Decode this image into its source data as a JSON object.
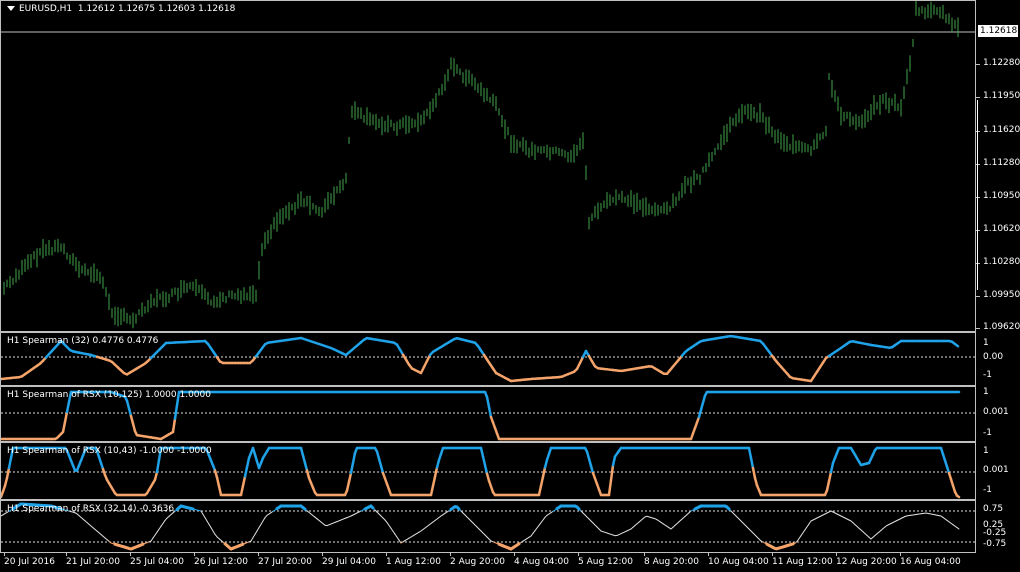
{
  "main": {
    "symbol_label": "EURUSD,H1",
    "ohlc": "1.12612 1.12675 1.12603 1.12618",
    "price_ticks": [
      "1.12618",
      "1.12280",
      "1.11950",
      "1.11620",
      "1.11280",
      "1.10950",
      "1.10620",
      "1.10280",
      "1.09950",
      "1.09620"
    ],
    "current_price": "1.12618",
    "candle_color": "#3fa34d"
  },
  "ind1": {
    "label": "H1 Spearman (32) 0.4776 0.4776",
    "ticks": [
      "1",
      "0.00",
      "-1"
    ]
  },
  "ind2": {
    "label": "H1 Spearman of RSX (10,125) 1.0000 1.0000",
    "ticks": [
      "1",
      "0.001",
      "-1"
    ]
  },
  "ind3": {
    "label": "H1 Spearman of RSX (10,43) -1.0000 -1.0000",
    "ticks": [
      "1",
      "0.001",
      "-1"
    ]
  },
  "ind4": {
    "label": "H1 Spearman of RSX (32,14) -0.3636",
    "ticks": [
      "0.75",
      "0.25",
      "-0.25",
      "-0.75"
    ]
  },
  "xaxis": [
    "20 Jul 2016",
    "21 Jul 20:00",
    "25 Jul 04:00",
    "26 Jul 12:00",
    "27 Jul 20:00",
    "29 Jul 04:00",
    "1 Aug 12:00",
    "2 Aug 20:00",
    "4 Aug 04:00",
    "5 Aug 12:00",
    "8 Aug 20:00",
    "10 Aug 04:00",
    "11 Aug 12:00",
    "12 Aug 20:00",
    "16 Aug 04:00"
  ],
  "colors": {
    "up": "#1fa2e8",
    "down": "#f4a46a",
    "neutral": "#e0e0e0"
  }
}
